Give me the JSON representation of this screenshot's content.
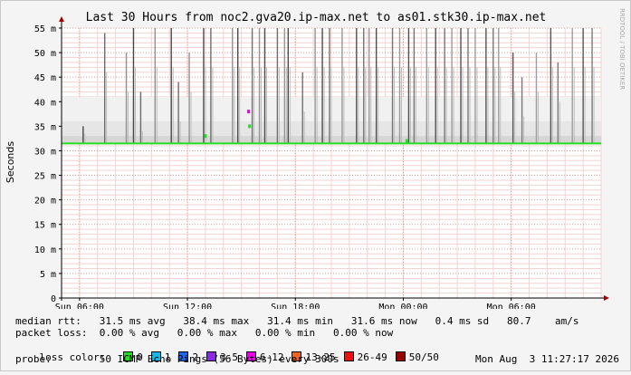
{
  "chart_data": {
    "type": "area",
    "title": "Last 30 Hours from noc2.gva20.ip-max.net to as01.stk30.ip-max.net",
    "ylabel": "Seconds",
    "watermark": "RRDTOOL / TOBI OETIKER",
    "ylim": [
      0,
      55
    ],
    "yticks": [
      {
        "value": 0,
        "label": "0"
      },
      {
        "value": 5,
        "label": "5 m"
      },
      {
        "value": 10,
        "label": "10 m"
      },
      {
        "value": 15,
        "label": "15 m"
      },
      {
        "value": 20,
        "label": "20 m"
      },
      {
        "value": 25,
        "label": "25 m"
      },
      {
        "value": 30,
        "label": "30 m"
      },
      {
        "value": 35,
        "label": "35 m"
      },
      {
        "value": 40,
        "label": "40 m"
      },
      {
        "value": 45,
        "label": "45 m"
      },
      {
        "value": 50,
        "label": "50 m"
      },
      {
        "value": 55,
        "label": "55 m"
      }
    ],
    "xlim": [
      0,
      30
    ],
    "xticks": [
      {
        "value": 1.0,
        "label": "Sun 06:00"
      },
      {
        "value": 7.0,
        "label": "Sun 12:00"
      },
      {
        "value": 13.0,
        "label": "Sun 18:00"
      },
      {
        "value": 19.0,
        "label": "Mon 00:00"
      },
      {
        "value": 25.0,
        "label": "Mon 06:00"
      }
    ],
    "series": [
      {
        "name": "median rtt",
        "color": "#22dd22",
        "y": 31.5
      }
    ],
    "spikes": [
      {
        "x": 1.2,
        "top": 35
      },
      {
        "x": 2.4,
        "top": 54
      },
      {
        "x": 3.6,
        "top": 50
      },
      {
        "x": 4.0,
        "top": 55
      },
      {
        "x": 4.4,
        "top": 42
      },
      {
        "x": 5.2,
        "top": 55
      },
      {
        "x": 6.1,
        "top": 55
      },
      {
        "x": 6.5,
        "top": 44
      },
      {
        "x": 7.1,
        "top": 50
      },
      {
        "x": 7.9,
        "top": 55
      },
      {
        "x": 8.3,
        "top": 55
      },
      {
        "x": 9.5,
        "top": 55
      },
      {
        "x": 9.8,
        "top": 55
      },
      {
        "x": 10.6,
        "top": 55
      },
      {
        "x": 11.0,
        "top": 55
      },
      {
        "x": 11.3,
        "top": 55
      },
      {
        "x": 12.0,
        "top": 55
      },
      {
        "x": 12.4,
        "top": 55
      },
      {
        "x": 12.6,
        "top": 55
      },
      {
        "x": 13.4,
        "top": 46
      },
      {
        "x": 14.1,
        "top": 55
      },
      {
        "x": 14.5,
        "top": 55
      },
      {
        "x": 14.9,
        "top": 55
      },
      {
        "x": 15.6,
        "top": 55
      },
      {
        "x": 16.4,
        "top": 55
      },
      {
        "x": 16.8,
        "top": 55
      },
      {
        "x": 17.1,
        "top": 55
      },
      {
        "x": 17.5,
        "top": 55
      },
      {
        "x": 18.4,
        "top": 55
      },
      {
        "x": 18.8,
        "top": 55
      },
      {
        "x": 19.3,
        "top": 55
      },
      {
        "x": 19.6,
        "top": 55
      },
      {
        "x": 20.3,
        "top": 55
      },
      {
        "x": 20.8,
        "top": 55
      },
      {
        "x": 21.3,
        "top": 55
      },
      {
        "x": 21.7,
        "top": 55
      },
      {
        "x": 22.2,
        "top": 55
      },
      {
        "x": 22.6,
        "top": 55
      },
      {
        "x": 23.0,
        "top": 55
      },
      {
        "x": 23.6,
        "top": 55
      },
      {
        "x": 24.0,
        "top": 55
      },
      {
        "x": 24.3,
        "top": 55
      },
      {
        "x": 25.1,
        "top": 50
      },
      {
        "x": 25.6,
        "top": 45
      },
      {
        "x": 26.4,
        "top": 50
      },
      {
        "x": 27.2,
        "top": 55
      },
      {
        "x": 27.6,
        "top": 48
      },
      {
        "x": 28.4,
        "top": 55
      },
      {
        "x": 29.0,
        "top": 55
      },
      {
        "x": 29.5,
        "top": 55
      }
    ],
    "loss_markers": [
      {
        "x": 8.0,
        "y": 33,
        "color": "#22dd22"
      },
      {
        "x": 10.4,
        "y": 38,
        "color": "#ee00ee"
      },
      {
        "x": 10.45,
        "y": 35,
        "color": "#22dd22"
      },
      {
        "x": 19.2,
        "y": 32,
        "color": "#22dd22"
      }
    ]
  },
  "legend": {
    "median_rtt": "median rtt:   31.5 ms avg   38.4 ms max   31.4 ms min   31.6 ms now   0.4 ms sd   80.7    am/s",
    "packet_loss": "packet loss:  0.00 % avg   0.00 % max   0.00 % min   0.00 % now",
    "loss_color_label": "loss color:",
    "loss_colors": [
      {
        "label": "0",
        "color": "#22dd22"
      },
      {
        "label": "1",
        "color": "#19b7e6"
      },
      {
        "label": "2",
        "color": "#2266ee"
      },
      {
        "label": "3-5",
        "color": "#8a2be2"
      },
      {
        "label": "6-12",
        "color": "#ee00ee"
      },
      {
        "label": "13-25",
        "color": "#ee6622"
      },
      {
        "label": "26-49",
        "color": "#ee1111"
      },
      {
        "label": "50/50",
        "color": "#990000"
      }
    ],
    "probe": "probe:        50 ICMP Echo Pings (56 Bytes) every 300s",
    "timestamp": "Mon Aug  3 11:27:17 2026"
  }
}
